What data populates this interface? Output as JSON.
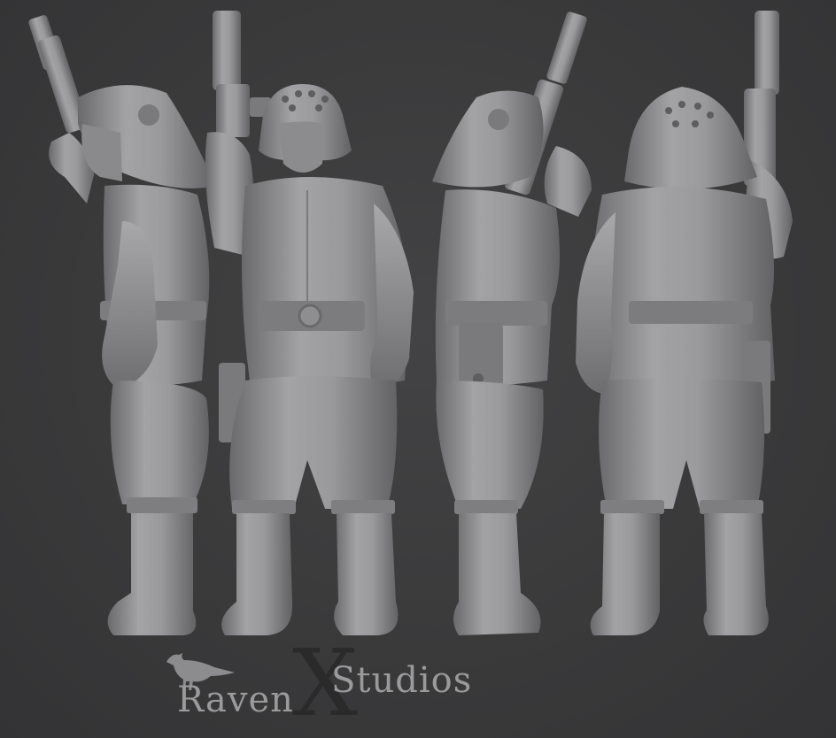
{
  "scene": {
    "background_color": "#3a3a3b",
    "figure_color": "#8e8e90",
    "shadow_color": "#5c5c5e",
    "highlight_color": "#b4b4b6",
    "views": [
      "left-side",
      "front",
      "right-side",
      "back"
    ]
  },
  "logo": {
    "word1": "Raven",
    "letter": "X",
    "word2": "Studios",
    "icon": "crow-icon"
  }
}
